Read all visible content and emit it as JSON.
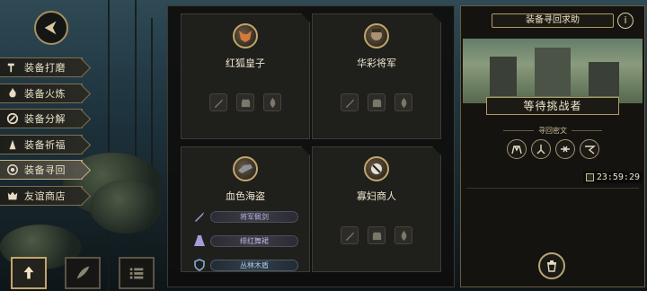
{
  "menu": {
    "items": [
      {
        "label": "装备打磨",
        "icon": "hammer-icon"
      },
      {
        "label": "装备火炼",
        "icon": "flame-icon"
      },
      {
        "label": "装备分解",
        "icon": "decompose-icon"
      },
      {
        "label": "装备祈福",
        "icon": "pray-icon"
      },
      {
        "label": "装备寻回",
        "icon": "retrieve-icon",
        "active": true
      },
      {
        "label": "友谊商店",
        "icon": "shop-icon"
      }
    ]
  },
  "slots": [
    {
      "name": "红狐皇子",
      "portrait": "fox-prince-portrait"
    },
    {
      "name": "华彩将军",
      "portrait": "general-portrait"
    },
    {
      "name": "血色海盗",
      "portrait": "pirate-portrait",
      "items": [
        {
          "label": "将军佩剑",
          "icon": "sword-icon",
          "color": "purple"
        },
        {
          "label": "绯红舞裙",
          "icon": "dress-icon",
          "color": "purple"
        },
        {
          "label": "丛林木盾",
          "icon": "shield-icon",
          "color": "blue"
        }
      ]
    },
    {
      "name": "寡妇商人",
      "portrait": "widow-merchant-portrait"
    }
  ],
  "right_panel": {
    "title": "装备寻回求助",
    "help": "i",
    "challenger_label": "等待挑战者",
    "subtitle": "寻回密文",
    "timer": "23:59:29"
  },
  "colors": {
    "accent": "#c0a56c",
    "panel": "#1f1f1c",
    "purple_text": "#bcb8e6",
    "blue_text": "#a9c9e8"
  }
}
